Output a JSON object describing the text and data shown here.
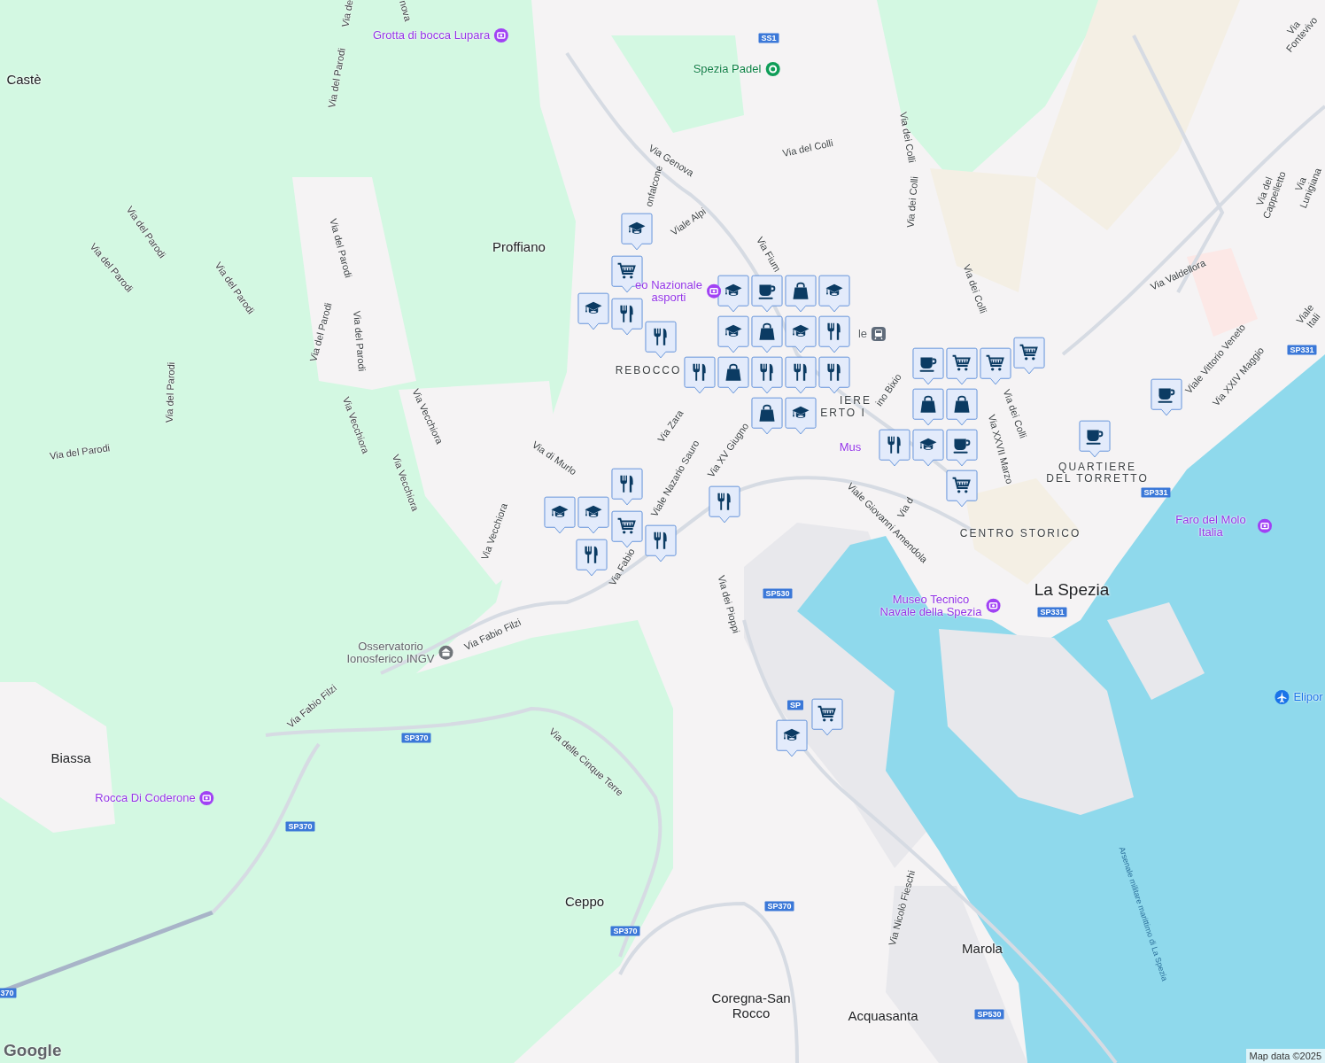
{
  "map": {
    "labels": [
      {
        "text": "Castè",
        "kind": "place"
      },
      {
        "text": "Grotta di bocca Lupara",
        "kind": "museum"
      },
      {
        "text": "Via de",
        "kind": "road"
      },
      {
        "text": "nova",
        "kind": "road"
      },
      {
        "text": "Via del Parodi",
        "kind": "road"
      },
      {
        "text": "Spezia Padel",
        "kind": "sport"
      },
      {
        "text": "Via Genova",
        "kind": "road"
      },
      {
        "text": "Via del Colli",
        "kind": "road"
      },
      {
        "text": "Via dei Colli",
        "kind": "road"
      },
      {
        "text": "Via dei Colli",
        "kind": "road"
      },
      {
        "text": "Via Fontevivo",
        "kind": "road"
      },
      {
        "text": "onfalcone",
        "kind": "road"
      },
      {
        "text": "Viale Alpi",
        "kind": "road"
      },
      {
        "text": "Via Fium",
        "kind": "road"
      },
      {
        "text": "Via del Cappelletto",
        "kind": "road"
      },
      {
        "text": "Via Lunigiana",
        "kind": "road"
      },
      {
        "text": "Via del Parodi",
        "kind": "road"
      },
      {
        "text": "Via del Parodi",
        "kind": "road"
      },
      {
        "text": "Via del Parodi",
        "kind": "road"
      },
      {
        "text": "Via del Parodi",
        "kind": "road"
      },
      {
        "text": "Proffiano",
        "kind": "place"
      },
      {
        "text": "eo Nazionale\nasporti",
        "kind": "museum"
      },
      {
        "text": "Via Valdellora",
        "kind": "road"
      },
      {
        "text": "Via dei Colli",
        "kind": "road"
      },
      {
        "text": "Viale Itali",
        "kind": "road"
      },
      {
        "text": "Via del Parodi",
        "kind": "road"
      },
      {
        "text": "Via del Parodi",
        "kind": "road"
      },
      {
        "text": "le",
        "kind": "station"
      },
      {
        "text": "REBOCCO",
        "kind": "district"
      },
      {
        "text": "Viale Vittorio Veneto",
        "kind": "road"
      },
      {
        "text": "Via XXIV Maggio",
        "kind": "road"
      },
      {
        "text": "Via del Parodi",
        "kind": "road"
      },
      {
        "text": "IERE",
        "kind": "district"
      },
      {
        "text": "ino Bixio",
        "kind": "road"
      },
      {
        "text": "ERTO I",
        "kind": "district"
      },
      {
        "text": "Via Vecchiora",
        "kind": "road"
      },
      {
        "text": "Via Vecchiora",
        "kind": "road"
      },
      {
        "text": "Via Zara",
        "kind": "road"
      },
      {
        "text": "Via XV Giugno",
        "kind": "road"
      },
      {
        "text": "Via dei Colli",
        "kind": "road"
      },
      {
        "text": "Via del Parodi",
        "kind": "road"
      },
      {
        "text": "Via di Murlo",
        "kind": "road"
      },
      {
        "text": "Mus",
        "kind": "poi_text"
      },
      {
        "text": "Viale Nazario Sauro",
        "kind": "road"
      },
      {
        "text": "Via XXVII Marzo",
        "kind": "road"
      },
      {
        "text": "QUARTIERE\nDEL TORRETTO",
        "kind": "district"
      },
      {
        "text": "Via Vecchiora",
        "kind": "road"
      },
      {
        "text": "Via d",
        "kind": "road"
      },
      {
        "text": "Viale Giovanni Amendola",
        "kind": "road"
      },
      {
        "text": "CENTRO STORICO",
        "kind": "district"
      },
      {
        "text": "Faro del Molo Italia",
        "kind": "museum"
      },
      {
        "text": "Via Vecchiora",
        "kind": "road"
      },
      {
        "text": "Via Fabio",
        "kind": "road"
      },
      {
        "text": "La Spezia",
        "kind": "city"
      },
      {
        "text": "Via dei Pioppi",
        "kind": "road"
      },
      {
        "text": "Museo Tecnico\nNavale della Spezia",
        "kind": "museum"
      },
      {
        "text": "Via Fabio Filzi",
        "kind": "road"
      },
      {
        "text": "Osservatorio\nIonosferico INGV",
        "kind": "research"
      },
      {
        "text": "Elipor",
        "kind": "airport"
      },
      {
        "text": "Via Fabio Filzi",
        "kind": "road"
      },
      {
        "text": "Via delle Cinque Terre",
        "kind": "road"
      },
      {
        "text": "Biassa",
        "kind": "place"
      },
      {
        "text": "Rocca Di Coderone",
        "kind": "museum"
      },
      {
        "text": "Ceppo",
        "kind": "place"
      },
      {
        "text": "Via Nicolò Fieschi",
        "kind": "road"
      },
      {
        "text": "Arsenale militare marittimo di La Spezia",
        "kind": "water"
      },
      {
        "text": "Marola",
        "kind": "place"
      },
      {
        "text": "Coregna-San\nRocco",
        "kind": "place"
      },
      {
        "text": "Acquasanta",
        "kind": "place"
      }
    ],
    "route_shields": [
      "SS1",
      "SP530",
      "SP370",
      "SP370",
      "SP370",
      "SP370",
      "370",
      "SP530",
      "SP331",
      "SP331",
      "SP331",
      "SP"
    ],
    "markers": [
      {
        "kind": "school"
      },
      {
        "kind": "cart"
      },
      {
        "kind": "school"
      },
      {
        "kind": "food"
      },
      {
        "kind": "food"
      },
      {
        "kind": "school"
      },
      {
        "kind": "cup"
      },
      {
        "kind": "bag"
      },
      {
        "kind": "school"
      },
      {
        "kind": "school"
      },
      {
        "kind": "bag"
      },
      {
        "kind": "school"
      },
      {
        "kind": "food"
      },
      {
        "kind": "bag"
      },
      {
        "kind": "food"
      },
      {
        "kind": "food"
      },
      {
        "kind": "food"
      },
      {
        "kind": "bag"
      },
      {
        "kind": "school"
      },
      {
        "kind": "food"
      },
      {
        "kind": "cup"
      },
      {
        "kind": "cart"
      },
      {
        "kind": "cart"
      },
      {
        "kind": "food"
      },
      {
        "kind": "bag"
      },
      {
        "kind": "bag"
      },
      {
        "kind": "cart"
      },
      {
        "kind": "school"
      },
      {
        "kind": "cup"
      },
      {
        "kind": "cart"
      },
      {
        "kind": "cup"
      },
      {
        "kind": "cup"
      },
      {
        "kind": "food"
      },
      {
        "kind": "food"
      },
      {
        "kind": "school"
      },
      {
        "kind": "school"
      },
      {
        "kind": "cart"
      },
      {
        "kind": "food"
      },
      {
        "kind": "food"
      },
      {
        "kind": "cart"
      },
      {
        "kind": "school"
      }
    ],
    "logo": "Google",
    "attribution": "Map data ©2025"
  }
}
